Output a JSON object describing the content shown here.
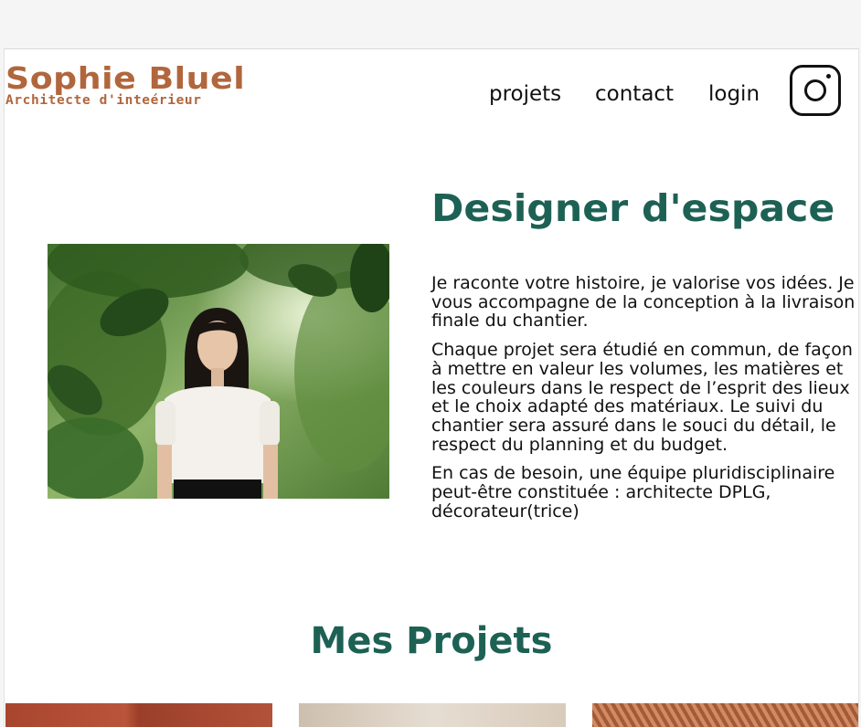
{
  "colors": {
    "brand": "#b1663c",
    "accent": "#1d6154",
    "text": "#111111"
  },
  "header": {
    "name": "Sophie Bluel",
    "subtitle": "Architecte d'inteérieur",
    "nav": {
      "projects": "projets",
      "contact": "contact",
      "login": "login"
    },
    "instagram_icon": "instagram-icon"
  },
  "intro": {
    "title": "Designer d'espace",
    "paragraphs": [
      "Je raconte votre histoire, je valorise vos idées. Je vous accompagne de la conception à la livraison finale du chantier.",
      "Chaque projet sera étudié en commun, de façon à mettre en valeur les volumes, les matières et les couleurs dans le respect de l’esprit des lieux et le choix adapté des matériaux. Le suivi du chantier sera assuré dans le souci du détail, le respect du planning et du budget.",
      "En cas de besoin, une équipe pluridisciplinaire peut-être constituée : architecte DPLG, décorateur(trice)"
    ]
  },
  "projects": {
    "title": "Mes Projets"
  }
}
